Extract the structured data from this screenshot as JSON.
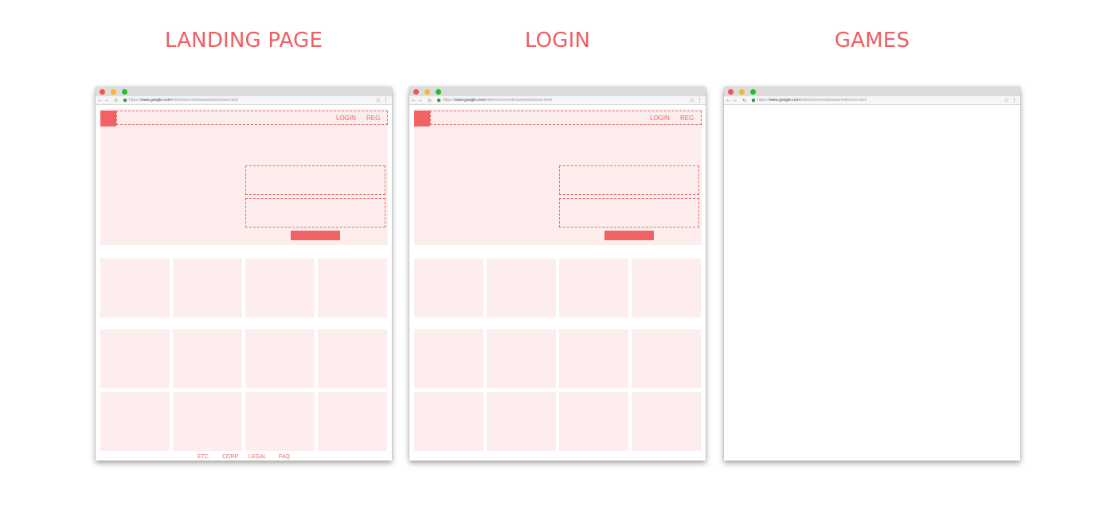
{
  "colors": {
    "accent": "#f26163",
    "tint": "#fdeded",
    "dashed_border": "#e4706f",
    "heading": "#ef5e61"
  },
  "browser": {
    "url_prefix": "https://",
    "url_domain": "www.google.com",
    "url_path": "/intl/en/chrome/browser/welcome.html",
    "back_icon": "arrow-left-icon",
    "forward_icon": "arrow-right-icon",
    "reload_icon": "reload-icon",
    "bookmark_icon": "star-icon",
    "menu_icon": "kebab-menu-icon"
  },
  "screens": [
    {
      "title": "LANDING PAGE",
      "nav": {
        "login": "LOGIN",
        "reg": "REG"
      },
      "footer": [
        "ETC",
        "CORP",
        "LEGAL",
        "FAQ"
      ]
    },
    {
      "title": "LOGIN",
      "nav": {
        "login": "LOGIN",
        "reg": "REG"
      }
    },
    {
      "title": "GAMES"
    }
  ]
}
